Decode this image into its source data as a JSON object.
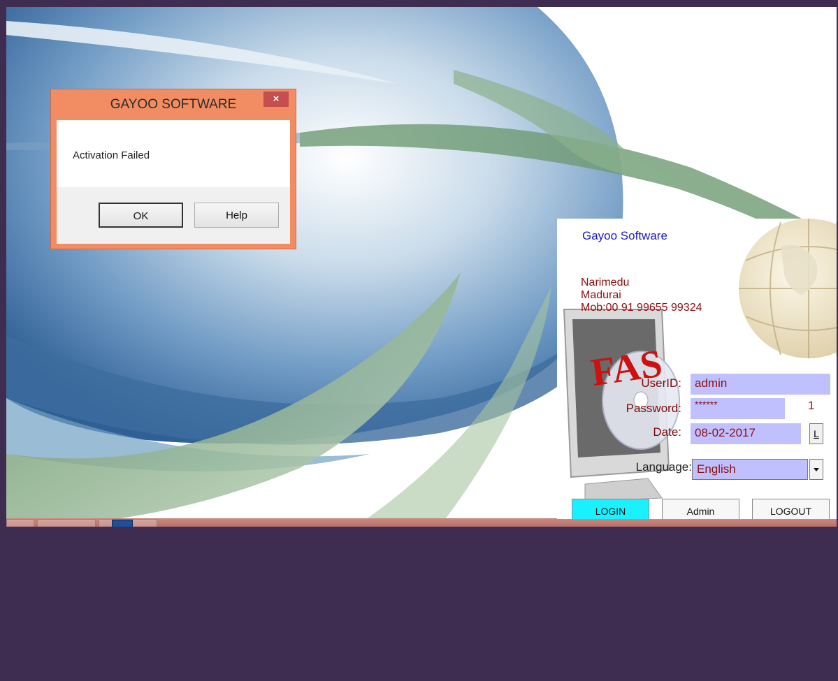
{
  "dialog": {
    "title": "GAYOO SOFTWARE",
    "close_label": "×",
    "message": "Activation Failed",
    "ok_label": "OK",
    "help_label": "Help"
  },
  "login": {
    "company": "Gayoo  Software",
    "address_line1": "Narimedu",
    "address_line2": "Madurai",
    "mobile": "Mob:00  91  99655  99324",
    "logo_text": "FAS",
    "userid_label": "UserID:",
    "userid_value": "admin",
    "password_label": "Password:",
    "password_value": "******",
    "attempt_count": "1",
    "date_label": "Date:",
    "date_value": "08-02-2017",
    "date_button": "L",
    "language_label": "Language:",
    "language_value": "English",
    "login_button": "LOGIN",
    "admin_button": "Admin",
    "logout_button": "LOGOUT"
  },
  "colors": {
    "desktop_bg": "#3f2d51",
    "dialog_frame": "#f28c62",
    "field_bg": "#c1c0ff",
    "login_btn": "#19f1ff",
    "label_red": "#8b1010",
    "company_blue": "#1b1bbf"
  },
  "icons": [
    "close-icon",
    "dropdown-arrow-icon",
    "monitor-cd-icon",
    "globe-icon"
  ]
}
